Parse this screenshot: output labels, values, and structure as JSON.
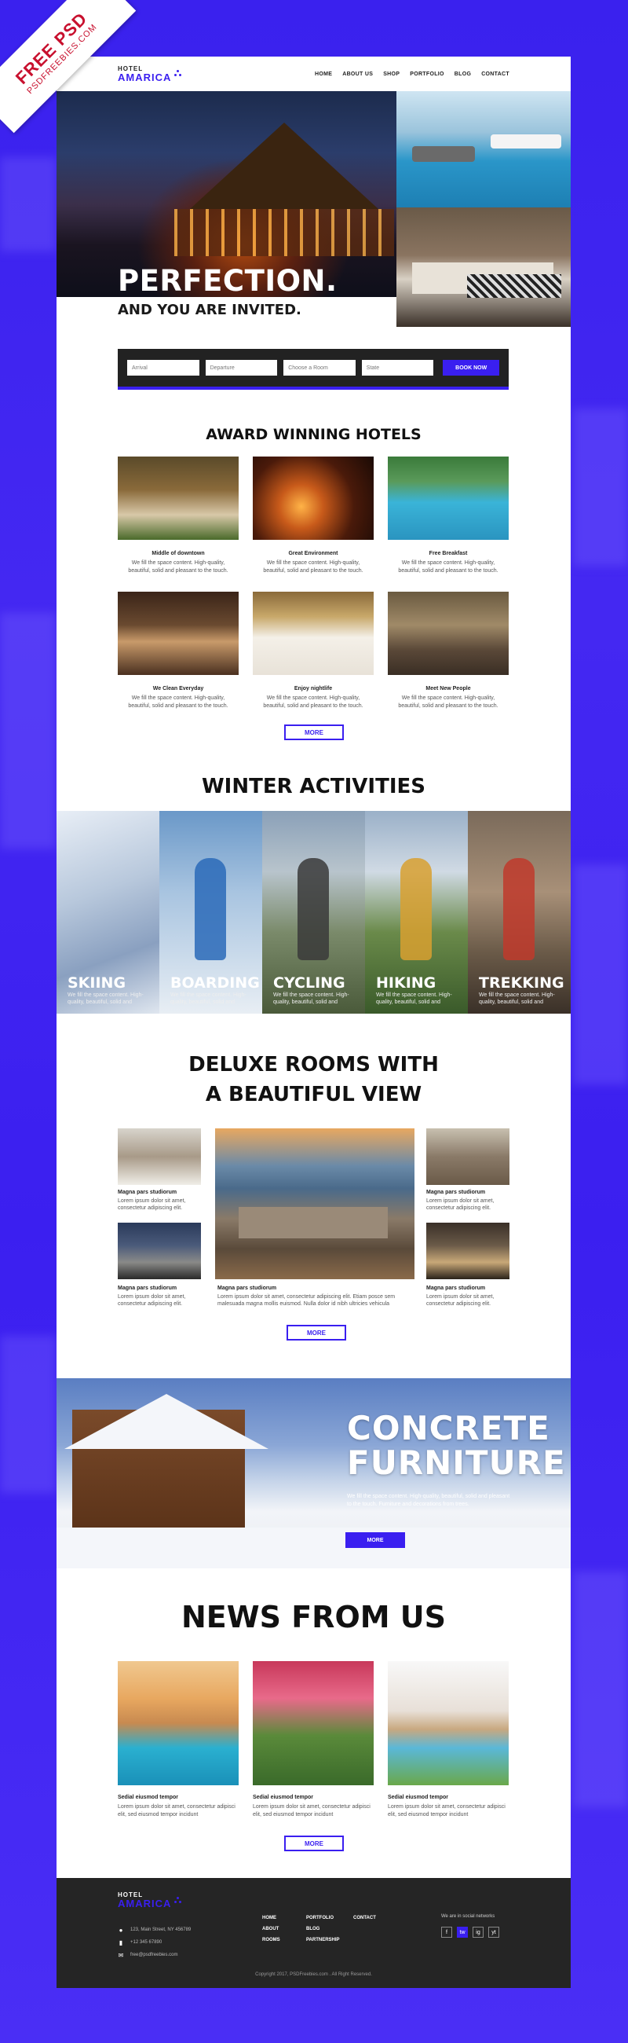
{
  "ribbon": {
    "line1": "FREE PSD",
    "line2": "PSDFREEBIES.COM"
  },
  "header": {
    "logo_top": "HOTEL",
    "logo_bottom": "AMARICA",
    "nav": [
      "HOME",
      "ABOUT US",
      "SHOP",
      "PORTFOLIO",
      "BLOG",
      "CONTACT"
    ]
  },
  "hero": {
    "title": "PERFECTION.",
    "subtitle": "AND YOU ARE INVITED."
  },
  "booking": {
    "arrival": "Arrival",
    "departure": "Departure",
    "room": "Choose a Room",
    "state": "State",
    "button": "BOOK NOW"
  },
  "award": {
    "title": "AWARD WINNING HOTELS",
    "items": [
      {
        "title": "Middle of downtown",
        "desc": "We fill the space content. High-quality, beautiful, solid and pleasant to the touch."
      },
      {
        "title": "Great Environment",
        "desc": "We fill the space content. High-quality, beautiful, solid and pleasant to the touch."
      },
      {
        "title": "Free Breakfast",
        "desc": "We fill the space content. High-quality, beautiful, solid and pleasant to the touch."
      },
      {
        "title": "We Clean Everyday",
        "desc": "We fill the space content. High-quality, beautiful, solid and pleasant to the touch."
      },
      {
        "title": "Enjoy nightlife",
        "desc": "We fill the space content. High-quality, beautiful, solid and pleasant to the touch."
      },
      {
        "title": "Meet New People",
        "desc": "We fill the space content. High-quality, beautiful, solid and pleasant to the touch."
      }
    ],
    "more": "MORE"
  },
  "winter": {
    "title": "WINTER ACTIVITIES",
    "items": [
      {
        "label": "SKIING",
        "desc": "We fill the space content. High-quality, beautiful, solid and"
      },
      {
        "label": "BOARDING",
        "desc": "We fill the space content. High-quality, beautiful, solid and"
      },
      {
        "label": "CYCLING",
        "desc": "We fill the space content. High-quality, beautiful, solid and"
      },
      {
        "label": "HIKING",
        "desc": "We fill the space content. High-quality, beautiful, solid and"
      },
      {
        "label": "TREKKING",
        "desc": "We fill the space content. High-quality, beautiful, solid and"
      }
    ]
  },
  "deluxe": {
    "title_line1": "DELUXE ROOMS WITH",
    "title_line2": "A BEAUTIFUL VIEW",
    "small_title": "Magna pars studiorum",
    "small_desc_1": "Lorem ipsum dolor sit amet,",
    "small_desc_2": "consectetur adipiscing elit.",
    "center_title": "Magna pars studiorum",
    "center_desc": "Lorem ipsum dolor sit amet, consectetur adipiscing elit. Etiam posce sem malesuada magna mollis euismod. Nulla dolor id nibh ultricies vehicula",
    "more": "MORE"
  },
  "banner": {
    "title_line1": "CONCRETE",
    "title_line2": "FURNITURE",
    "text": "We fill the space content. High-quality, beautiful, solid and pleasant to the touch. Furniture and decorations from trees.",
    "button": "MORE"
  },
  "news": {
    "title": "NEWS FROM US",
    "items": [
      {
        "title": "Sedial eiusmod tempor",
        "desc": "Lorem ipsum dolor sit amet, consectetur adipisci elit, sed eiusmod tempor incidunt"
      },
      {
        "title": "Sedial eiusmod tempor",
        "desc": "Lorem ipsum dolor sit amet, consectetur adipisci elit, sed eiusmod tempor incidunt"
      },
      {
        "title": "Sedial eiusmod tempor",
        "desc": "Lorem ipsum dolor sit amet, consectetur adipisci elit, sed eiusmod tempor incidunt"
      }
    ],
    "more": "MORE"
  },
  "footer": {
    "logo_top": "HOTEL",
    "logo_bottom": "AMARICA",
    "address": "123, Main Street, NY 456789",
    "phone": "+12 345 67890",
    "email": "free@psdfreebies.com",
    "links_col1": [
      "HOME",
      "ABOUT",
      "ROOMS"
    ],
    "links_col2": [
      "PORTFOLIO",
      "BLOG",
      "PARTNERSHIP"
    ],
    "links_col3": [
      "CONTACT"
    ],
    "social_label": "We are in social networks",
    "social": [
      "f",
      "tw",
      "ig",
      "yt"
    ],
    "copyright": "Copyright 2017, PSDFreebies.com . All Right Reserved."
  },
  "colors": {
    "accent": "#3a1ff0",
    "footer_bg": "#252525"
  }
}
